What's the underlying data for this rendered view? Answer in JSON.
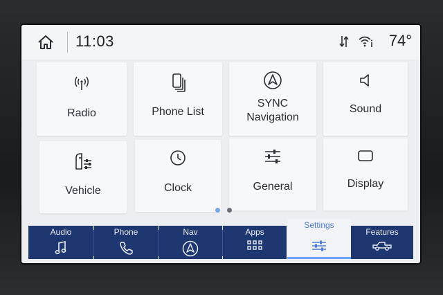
{
  "status": {
    "time": "11:03",
    "temperature": "74°",
    "icons": [
      "home-icon",
      "data-transfer-icon",
      "wifi-icon"
    ]
  },
  "tiles": [
    {
      "label": "Radio",
      "icon": "radio-antenna-icon"
    },
    {
      "label": "Phone List",
      "icon": "phone-list-icon"
    },
    {
      "label": "SYNC\nNavigation",
      "icon": "navigation-icon"
    },
    {
      "label": "Sound",
      "icon": "speaker-icon"
    },
    {
      "label": "Vehicle",
      "icon": "vehicle-settings-icon"
    },
    {
      "label": "Clock",
      "icon": "clock-icon"
    },
    {
      "label": "General",
      "icon": "sliders-icon"
    },
    {
      "label": "Display",
      "icon": "display-icon"
    }
  ],
  "pager": {
    "pages": 2,
    "current": 1
  },
  "nav": [
    {
      "label": "Audio",
      "icon": "music-note-icon"
    },
    {
      "label": "Phone",
      "icon": "phone-icon"
    },
    {
      "label": "Nav",
      "icon": "navigation-icon"
    },
    {
      "label": "Apps",
      "icon": "apps-grid-icon"
    },
    {
      "label": "Settings",
      "icon": "settings-sliders-icon",
      "active": true
    },
    {
      "label": "Features",
      "icon": "truck-icon"
    }
  ],
  "colors": {
    "nav_bg": "#1f3770",
    "active_accent": "#4c7bd6",
    "dot_active": "#7aa6e6",
    "dot_inactive": "#6b6f78"
  }
}
